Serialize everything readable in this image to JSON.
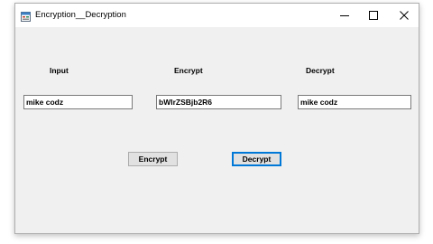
{
  "window": {
    "title": "Encryption__Decryption",
    "app_icon": "form-icon",
    "controls": [
      "minimize-icon",
      "maximize-icon",
      "close-icon"
    ]
  },
  "labels": {
    "input": "Input",
    "encrypt": "Encrypt",
    "decrypt": "Decrypt"
  },
  "fields": {
    "input_value": "mike codz",
    "encrypt_value": "bWlrZSBjb2R6",
    "decrypt_value": "mike codz"
  },
  "buttons": {
    "encrypt_label": "Encrypt",
    "decrypt_label": "Decrypt"
  },
  "colors": {
    "focus_accent": "#0078d7",
    "window_bg": "#f0f0f0"
  }
}
